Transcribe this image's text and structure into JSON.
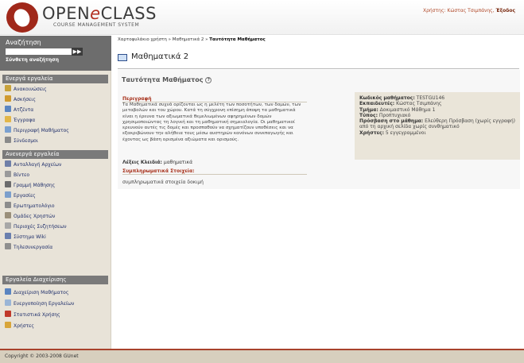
{
  "header": {
    "brand_open": "OPEN",
    "brand_e": "e",
    "brand_class": "CLASS",
    "tagline": "COURSE MANAGEMENT SYSTEM",
    "user_label": "Χρήστης: Κώστας Τσιμπάνης,",
    "logout_label": "Έξοδος"
  },
  "sidebar": {
    "search_title": "Αναζήτηση",
    "search_value": "",
    "search_go": "▶▶",
    "advanced_search": "Σύνθετη αναζήτηση",
    "sections": [
      {
        "title": "Ενεργά εργαλεία",
        "items": [
          {
            "label": "Ανακοινώσεις",
            "icon": "megaphone-icon",
            "color": "#c8a23a"
          },
          {
            "label": "Ασκήσεις",
            "icon": "exercise-icon",
            "color": "#d09a2e"
          },
          {
            "label": "Ατζέντα",
            "icon": "calendar-icon",
            "color": "#5b86c2"
          },
          {
            "label": "Έγγραφα",
            "icon": "folder-icon",
            "color": "#e2b648"
          },
          {
            "label": "Περιγραφή Μαθήματος",
            "icon": "description-icon",
            "color": "#7aa0cf"
          },
          {
            "label": "Σύνδεσμοι",
            "icon": "link-icon",
            "color": "#8a8a8a"
          }
        ]
      },
      {
        "title": "Ανενεργά εργαλεία",
        "items": [
          {
            "label": "Ανταλλαγή Αρχείων",
            "icon": "file-exchange-icon",
            "color": "#6f7fa8"
          },
          {
            "label": "Βίντεο",
            "icon": "video-icon",
            "color": "#9a9a9a"
          },
          {
            "label": "Γραμμή Μάθησης",
            "icon": "learning-path-icon",
            "color": "#6b6b6b"
          },
          {
            "label": "Εργασίες",
            "icon": "assignments-icon",
            "color": "#7c9fcc"
          },
          {
            "label": "Ερωτηματολόγιο",
            "icon": "questionnaire-icon",
            "color": "#8c8c8c"
          },
          {
            "label": "Ομάδες Χρηστών",
            "icon": "groups-icon",
            "color": "#9a8f7a"
          },
          {
            "label": "Περιοχές Συζητήσεων",
            "icon": "forum-icon",
            "color": "#a7a7a7"
          },
          {
            "label": "Σύστημα Wiki",
            "icon": "wiki-icon",
            "color": "#6a7fae"
          },
          {
            "label": "Τηλεσυνεργασία",
            "icon": "conference-icon",
            "color": "#8f8f8f"
          }
        ]
      },
      {
        "title": "Εργαλεία Διαχείρισης",
        "items": [
          {
            "label": "Διαχείριση Μαθήματος",
            "icon": "course-admin-icon",
            "color": "#5a84c0"
          },
          {
            "label": "Ενεργοποίηση Εργαλείων",
            "icon": "tools-activate-icon",
            "color": "#9ab5d6"
          },
          {
            "label": "Στατιστικά Χρήσης",
            "icon": "statistics-icon",
            "color": "#c0392b"
          },
          {
            "label": "Χρήστες",
            "icon": "users-icon",
            "color": "#d8a53a"
          }
        ]
      }
    ]
  },
  "main": {
    "breadcrumb": {
      "part1": "Χαρτοφυλάκιο χρήστη",
      "sep": "»",
      "part2": "Μαθηματικά 2",
      "current": "Ταυτότητα Μαθήματος"
    },
    "course_title": "Μαθηματικά 2",
    "identity_title": "Ταυτότητα Μαθήματος",
    "help_glyph": "?",
    "description_label": "Περιγραφή",
    "description_text": "Τα Μαθηματικά συχνά ορίζονται ως η μελέτη των ποσοτήτων, των δομών, των μεταβολών και του χώρου. Κατά τη σύγχρονη επίσημη άποψη τα μαθηματικά είναι η έρευνα των αξιωματικά θεμελιωμένων αφηρημένων δομών χρησιμοποιώντας τη λογική και τη μαθηματική σημειολογία. Οι μαθηματικοί ερευνούν αυτές τις δομές και προσπαθούν να σχηματίζουν υποθέσεις και να εξακριβώνουν την αλήθεια τους μέσω αυστηρών κανόνων συνεπαγωγής και έχοντας ως βάση ορισμένα αξιώματα και ορισμούς.",
    "keywords_label": "Λέξεις Κλειδιά:",
    "keywords_value": "μαθηματικά",
    "extras_label": "Συμπληρωματικά Στοιχεία:",
    "extras_value": "συμπληρωματικά στοιχεία δοκιμή",
    "info": {
      "code_label": "Κωδικός μαθήματος:",
      "code_value": "TESTGU146",
      "instructor_label": "Εκπαιδευτές:",
      "instructor_value": "Κώστας Τσιμπάνης",
      "department_label": "Τμήμα:",
      "department_value": "Δοκιμαστικό Μάθημα 1",
      "level_label": "Τύπος:",
      "level_value": "Προπτυχιακό",
      "access_label": "Πρόσβαση στο μάθημα:",
      "access_value": "Ελεύθερη Πρόσβαση (χωρίς εγγραφή) από τη αρχική σελίδα χωρίς συνθηματικό",
      "users_label": "Χρήστες:",
      "users_value": "5 εγγεγραμμένοι"
    }
  },
  "footer": {
    "copyright": "Copyright © 2003-2008 GUnet"
  },
  "colors": {
    "brand_red": "#a0281a",
    "sidebar_bg": "#e8e3d8",
    "menu_head_bg": "#7a7a7a",
    "section_label": "#a7311b",
    "info_box_bg": "#eae5d9"
  }
}
